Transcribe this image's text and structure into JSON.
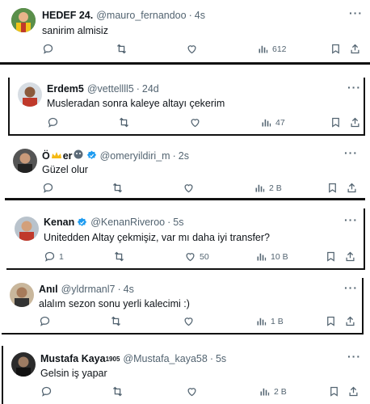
{
  "tweets": [
    {
      "name": "HEDEF 24.",
      "handle": "@mauro_fernandoo",
      "time": "4s",
      "text": "sanirim almisiz",
      "replies": "",
      "likes": "",
      "views": "612"
    },
    {
      "name": "Erdem5",
      "handle": "@vettellll5",
      "time": "24d",
      "text": "Musleradan sonra kaleye altayı çekerim",
      "replies": "",
      "likes": "",
      "views": "47"
    },
    {
      "name_part1": "Ö",
      "name_part2": "er",
      "handle": "@omeryildiri_m",
      "time": "2s",
      "text": "Güzel olur",
      "replies": "",
      "likes": "",
      "views": "2 B"
    },
    {
      "name": "Kenan",
      "handle": "@KenanRiveroo",
      "time": "5s",
      "text": "Unitedden Altay çekmişiz, var mı daha iyi transfer?",
      "replies": "1",
      "likes": "50",
      "views": "10 B"
    },
    {
      "name": "Anıl",
      "handle": "@yldrmanl7",
      "time": "4s",
      "text": "alalım sezon sonu yerli kalecimi :)",
      "replies": "",
      "likes": "",
      "views": "1 B"
    },
    {
      "name": "Mustafa Kaya",
      "name_sup": "1905",
      "handle": "@Mustafa_kaya58",
      "time": "5s",
      "text": "Gelsin iş yapar",
      "replies": "",
      "likes": "",
      "views": "2 B"
    }
  ],
  "separator": "·",
  "more_label": "···",
  "colors": {
    "text": "#0f1419",
    "muted": "#536471",
    "verified": "#1d9bf0",
    "border": "#111111"
  }
}
